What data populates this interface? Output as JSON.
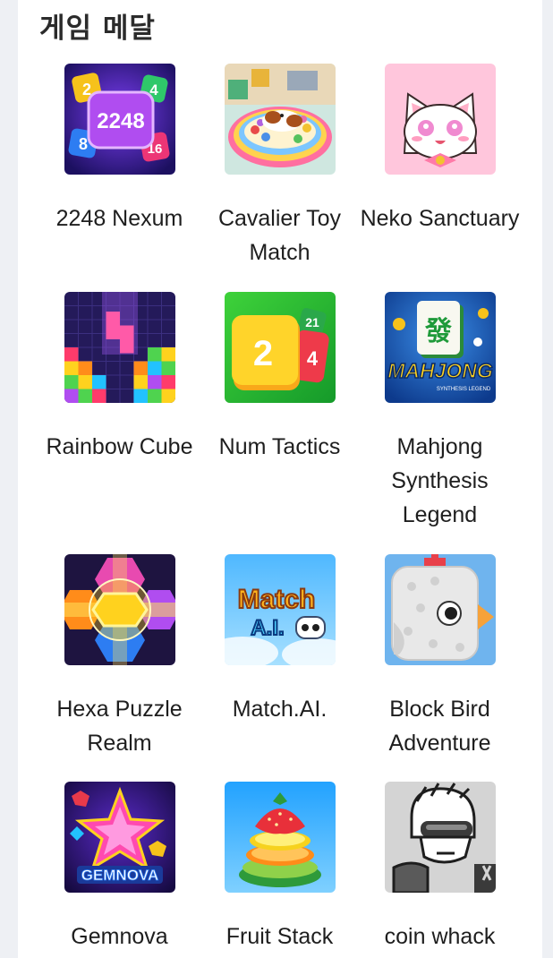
{
  "section": {
    "title": "게임 메달"
  },
  "games": [
    {
      "name": "2248 Nexum",
      "icon": "2248-nexum-icon"
    },
    {
      "name": "Cavalier Toy Match",
      "icon": "cavalier-toy-match-icon"
    },
    {
      "name": "Neko Sanctuary",
      "icon": "neko-sanctuary-icon"
    },
    {
      "name": "Rainbow Cube",
      "icon": "rainbow-cube-icon"
    },
    {
      "name": "Num Tactics",
      "icon": "num-tactics-icon"
    },
    {
      "name": "Mahjong Synthesis Legend",
      "icon": "mahjong-synthesis-legend-icon"
    },
    {
      "name": "Hexa Puzzle Realm",
      "icon": "hexa-puzzle-realm-icon"
    },
    {
      "name": "Match.AI.",
      "icon": "match-ai-icon"
    },
    {
      "name": "Block Bird Adventure",
      "icon": "block-bird-adventure-icon"
    },
    {
      "name": "Gemnova",
      "icon": "gemnova-icon"
    },
    {
      "name": "Fruit Stack",
      "icon": "fruit-stack-icon"
    },
    {
      "name": "coin whack",
      "icon": "coin-whack-icon"
    }
  ],
  "icon_art": {
    "nexum": {
      "tiles": [
        "2",
        "2248",
        "4",
        "8",
        "16"
      ]
    },
    "num_tactics": {
      "tiles": [
        "2",
        "4",
        "21"
      ]
    },
    "mahjong": {
      "tile": "發",
      "logo": "MAHJONG",
      "sublogo": "SYNTHESIS LEGEND"
    },
    "match_ai": {
      "logo_top": "Match",
      "logo_bottom": "A.I."
    },
    "gemnova": {
      "logo": "GEMNOVA"
    }
  }
}
